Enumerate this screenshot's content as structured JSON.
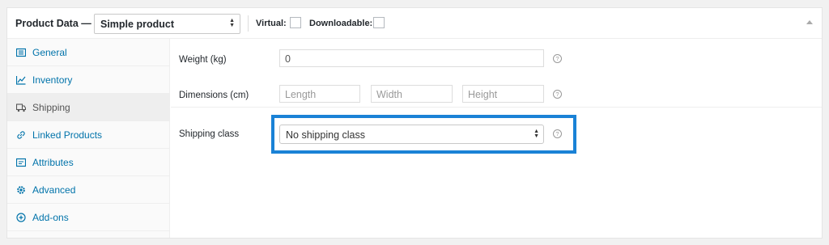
{
  "header": {
    "title": "Product Data —",
    "product_type": "Simple product",
    "virtual_label": "Virtual:",
    "downloadable_label": "Downloadable:"
  },
  "sidebar": {
    "items": [
      {
        "label": "General",
        "icon": "grid-icon"
      },
      {
        "label": "Inventory",
        "icon": "chart-icon"
      },
      {
        "label": "Shipping",
        "icon": "truck-icon"
      },
      {
        "label": "Linked Products",
        "icon": "link-icon"
      },
      {
        "label": "Attributes",
        "icon": "list-icon"
      },
      {
        "label": "Advanced",
        "icon": "gear-icon"
      },
      {
        "label": "Add-ons",
        "icon": "plus-circle-icon"
      }
    ],
    "active": "Shipping"
  },
  "shipping": {
    "weight_label": "Weight (kg)",
    "weight_placeholder": "0",
    "dimensions_label": "Dimensions (cm)",
    "length_placeholder": "Length",
    "width_placeholder": "Width",
    "height_placeholder": "Height",
    "class_label": "Shipping class",
    "class_value": "No shipping class",
    "help_glyph": "?"
  },
  "colors": {
    "link": "#0073aa",
    "highlight": "#1a82d6"
  }
}
